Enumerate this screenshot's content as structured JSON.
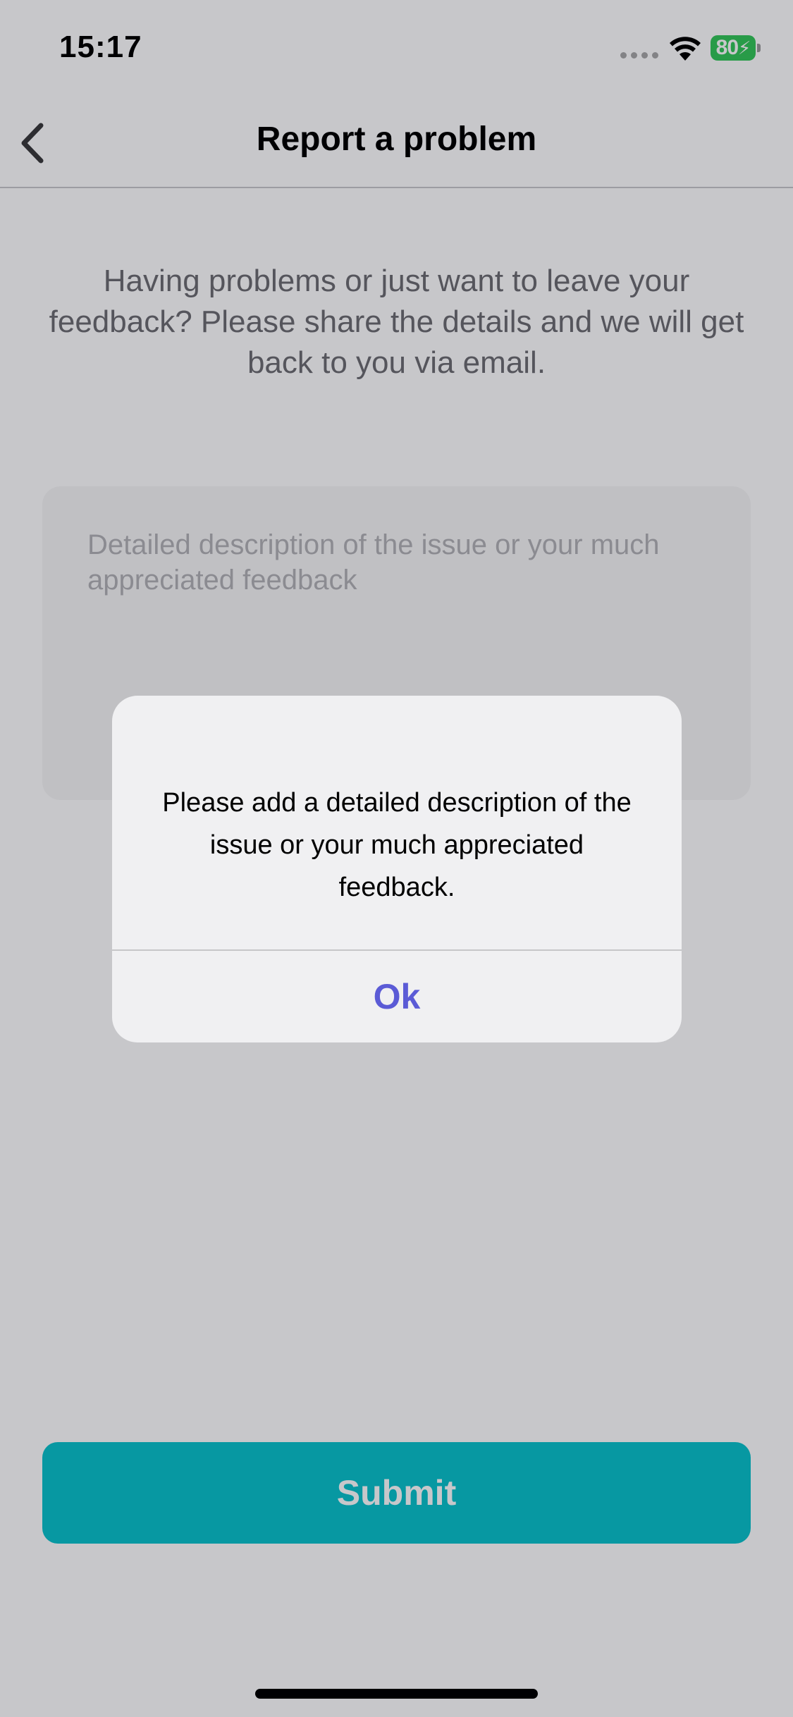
{
  "status_bar": {
    "time": "15:17",
    "battery_level": "80",
    "wifi_icon": "wifi-icon",
    "battery_icon": "battery-charging-icon"
  },
  "nav": {
    "back_icon": "chevron-left-icon",
    "title": "Report a problem"
  },
  "intro": {
    "text": "Having problems or just want to leave your feedback? Please share the details and we will get back to you via email."
  },
  "description_field": {
    "value": "",
    "placeholder": "Detailed description of the issue or your much appreciated feedback"
  },
  "submit": {
    "label": "Submit"
  },
  "alert": {
    "message": "Please add a detailed description of the issue or your much appreciated feedback.",
    "ok_label": "Ok"
  },
  "colors": {
    "accent": "#0ac3cc",
    "alert_button": "#5b5bd6",
    "battery": "#34c759"
  }
}
